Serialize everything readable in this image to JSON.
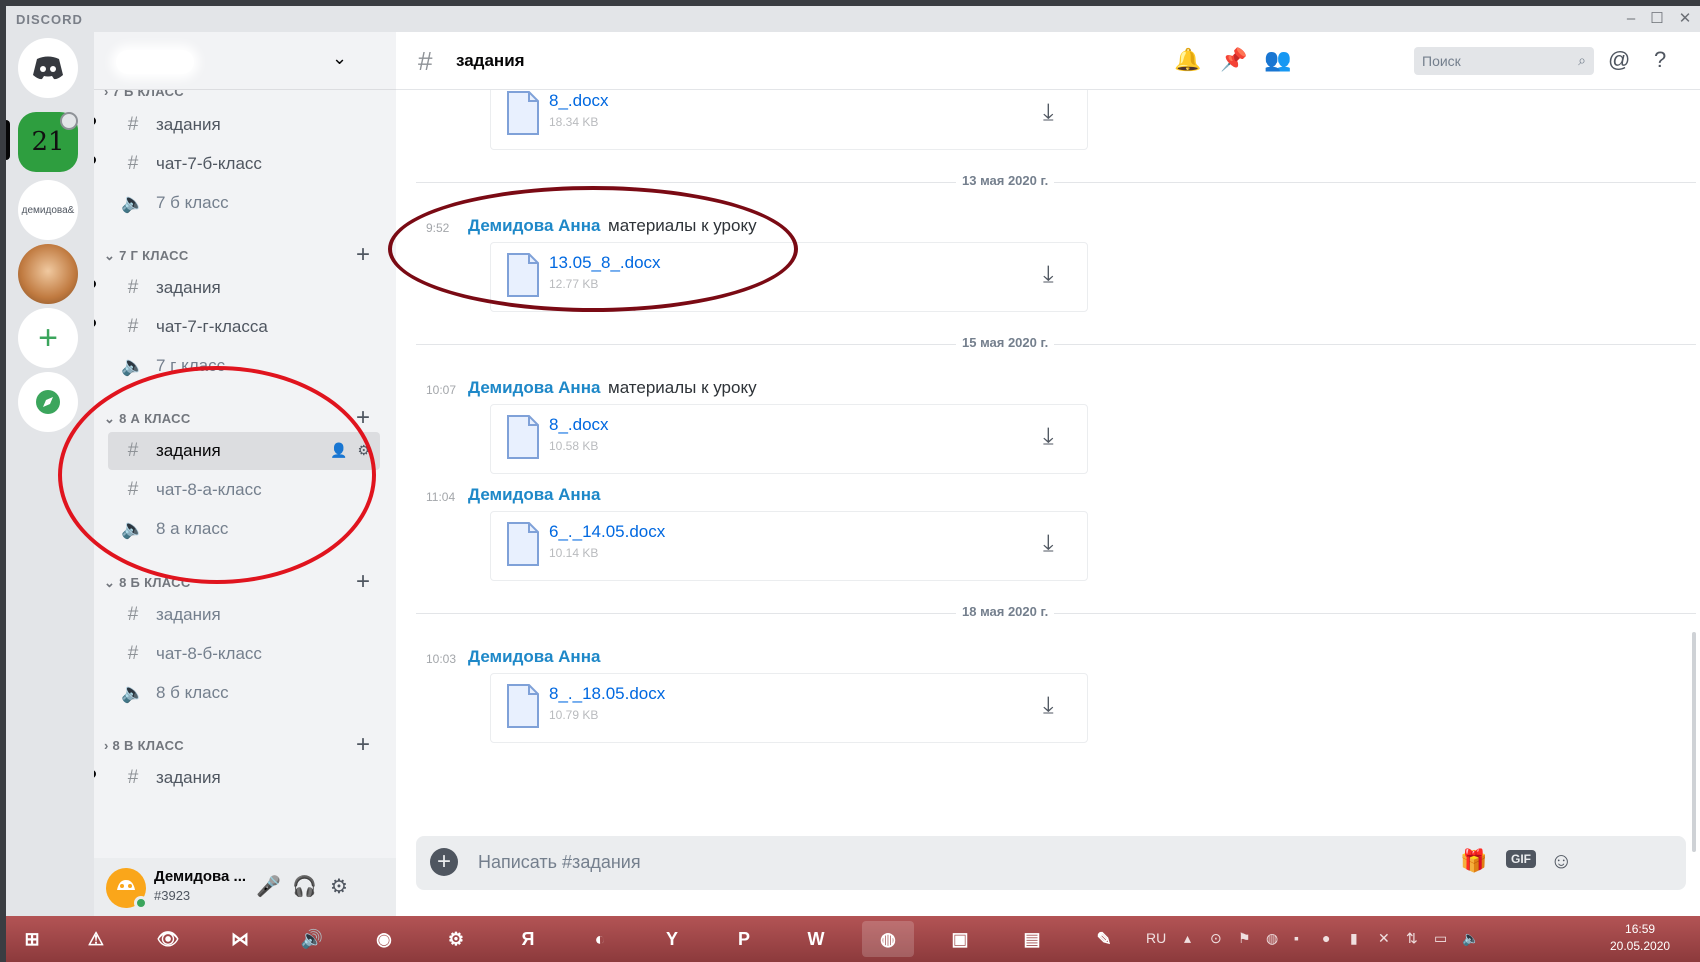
{
  "app": {
    "brand": "DISCORD"
  },
  "window": {
    "min": "–",
    "max": "☐",
    "close": "✕"
  },
  "servers": [
    {
      "icon": "discord-logo",
      "label": ""
    },
    {
      "icon": "server-21",
      "label": "21"
    },
    {
      "icon": "server-demidova",
      "label": "демидова&"
    },
    {
      "icon": "server-avatar",
      "label": ""
    },
    {
      "icon": "add-server",
      "label": "+"
    },
    {
      "icon": "explore-compass",
      "label": "⊘"
    }
  ],
  "sidebar": {
    "categories": [
      {
        "name": "7 Б КЛАСС",
        "channels": [
          {
            "type": "text",
            "name": "задания",
            "unread": true
          },
          {
            "type": "text",
            "name": "чат-7-б-класс",
            "unread": true
          },
          {
            "type": "voice",
            "name": "7 б класс"
          }
        ]
      },
      {
        "name": "7 Г КЛАСС",
        "channels": [
          {
            "type": "text",
            "name": "задания",
            "unread": true
          },
          {
            "type": "text",
            "name": "чат-7-г-класса",
            "unread": true
          },
          {
            "type": "voice",
            "name": "7 г класс"
          }
        ]
      },
      {
        "name": "8 А КЛАСС",
        "channels": [
          {
            "type": "text",
            "name": "задания",
            "selected": true
          },
          {
            "type": "text",
            "name": "чат-8-а-класс"
          },
          {
            "type": "voice",
            "name": "8 а класс"
          }
        ]
      },
      {
        "name": "8 Б КЛАСС",
        "channels": [
          {
            "type": "text",
            "name": "задания"
          },
          {
            "type": "text",
            "name": "чат-8-б-класс"
          },
          {
            "type": "voice",
            "name": "8 б класс"
          }
        ]
      },
      {
        "name": "8 В КЛАСС",
        "channels": [
          {
            "type": "text",
            "name": "задания",
            "unread": true
          }
        ]
      }
    ]
  },
  "user": {
    "name": "Демидова ...",
    "tag": "#3923"
  },
  "chat": {
    "channel": "задания",
    "search_placeholder": "Поиск",
    "composer_placeholder": "Написать #задания",
    "gif": "GIF",
    "first_file": {
      "name": "8_.docx",
      "size": "18.34 KB"
    },
    "days": [
      {
        "date": "13 мая 2020 г."
      },
      {
        "date": "15 мая 2020 г."
      },
      {
        "date": "18 мая 2020 г."
      }
    ],
    "messages": [
      {
        "time": "9:52",
        "author": "Демидова Анна",
        "text": "материалы к уроку",
        "file": {
          "name": "13.05_8_.docx",
          "size": "12.77 KB"
        }
      },
      {
        "time": "10:07",
        "author": "Демидова Анна",
        "text": "материалы к уроку",
        "file": {
          "name": "8_.docx",
          "size": "10.58 KB"
        }
      },
      {
        "time": "11:04",
        "author": "Демидова Анна",
        "text": "",
        "file": {
          "name": "6_._14.05.docx",
          "size": "10.14 KB"
        }
      },
      {
        "time": "10:03",
        "author": "Демидова Анна",
        "text": "",
        "file": {
          "name": "8_._18.05.docx",
          "size": "10.79 KB"
        }
      }
    ]
  },
  "taskbar": {
    "lang": "RU",
    "time": "16:59",
    "date": "20.05.2020",
    "apps": [
      "start",
      "avast",
      "eye",
      "visual-studio",
      "speaker",
      "chrome",
      "settings",
      "yandex-browser-ya",
      "audio",
      "yandex-y",
      "powerpoint",
      "word",
      "discord",
      "photos",
      "file-explorer",
      "paint"
    ]
  },
  "colors": {
    "author": "#1e88c8",
    "file_link": "#0068e0",
    "annotation_dark": "#7a0a14",
    "annotation_red": "#e0141e",
    "taskbar": "#a04648"
  }
}
